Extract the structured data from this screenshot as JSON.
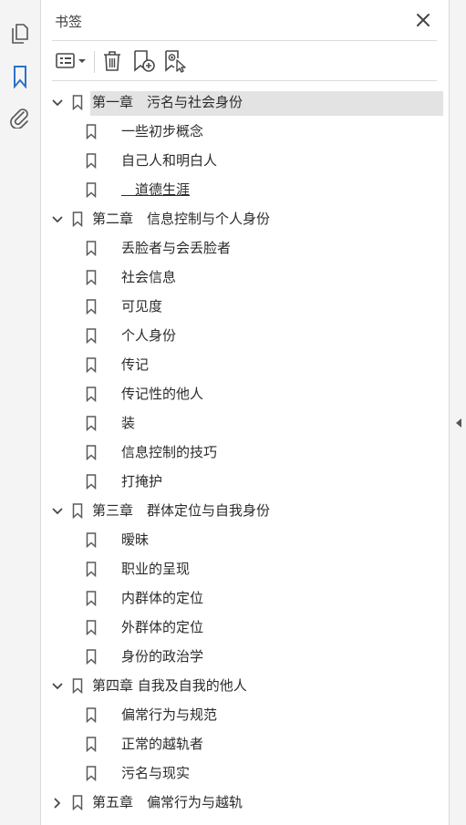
{
  "panel": {
    "title": "书签"
  },
  "icons": {
    "rail": [
      "pages-icon",
      "bookmark-icon",
      "attachment-icon"
    ],
    "toolbar": [
      "options-menu-icon",
      "delete-icon",
      "new-bookmark-icon",
      "find-bookmark-icon"
    ],
    "close": "close-icon",
    "collapse": "collapse-panel-icon"
  },
  "colors": {
    "accent": "#2a73c8",
    "icon": "#4a4a4a",
    "selected": "#e3e3e3"
  },
  "tree": [
    {
      "label": "第一章　污名与社会身份",
      "expanded": true,
      "selected": true,
      "children": [
        "一些初步概念",
        "自己人和明白人",
        "　道德生涯"
      ]
    },
    {
      "label": "第二章　信息控制与个人身份",
      "expanded": true,
      "children": [
        "丢脸者与会丢脸者",
        "社会信息",
        "可见度",
        "个人身份",
        "传记",
        "传记性的他人",
        "装",
        "信息控制的技巧",
        "打掩护"
      ]
    },
    {
      "label": "第三章　群体定位与自我身份",
      "expanded": true,
      "children": [
        "暧昧",
        "职业的呈现",
        "内群体的定位",
        "外群体的定位",
        "身份的政治学"
      ]
    },
    {
      "label": "第四章 自我及自我的他人",
      "expanded": true,
      "children": [
        "偏常行为与规范",
        "正常的越轨者",
        "污名与现实"
      ]
    },
    {
      "label": "第五章　偏常行为与越轨",
      "expanded": false,
      "children": []
    }
  ]
}
